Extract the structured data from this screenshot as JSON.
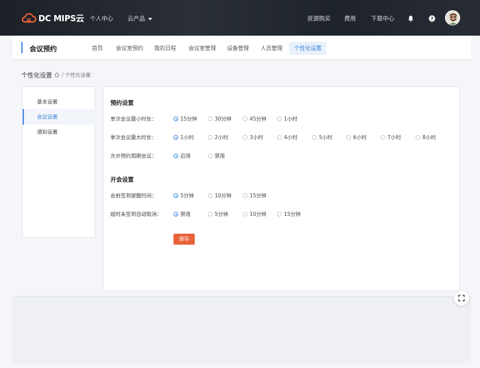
{
  "brand": {
    "logo_text": "DC MIPS云",
    "accent": "#e8623a",
    "primary": "#4a90e2"
  },
  "topnav": {
    "links": [
      "个人中心",
      "云产品"
    ],
    "right_links": [
      "资源购买",
      "费用",
      "下载中心"
    ],
    "icons": [
      "bell-icon",
      "help-icon"
    ]
  },
  "subheader": {
    "title": "会议预约",
    "tabs": [
      "首页",
      "会议室预约",
      "我的日程",
      "会议室管理",
      "设备管理",
      "人员管理",
      "个性化设置"
    ],
    "active_tab": "个性化设置"
  },
  "breadcrumb": {
    "page_title": "个性化设置",
    "path": "/ 个性化设置"
  },
  "sidemenu": {
    "items": [
      "基本设置",
      "会议设置",
      "通知设置"
    ],
    "active": "会议设置"
  },
  "booking": {
    "title": "预约设置",
    "min_duration": {
      "label": "单次会议最小时长：",
      "options": [
        "15分钟",
        "30分钟",
        "45分钟",
        "1小时"
      ],
      "selected": "15分钟"
    },
    "max_duration": {
      "label": "单次会议最大时长：",
      "options": [
        "1小时",
        "2小时",
        "3小时",
        "4小时",
        "5小时",
        "6小时",
        "7小时",
        "8小时"
      ],
      "selected": "1小时"
    },
    "recurring": {
      "label": "允许预约周期会议：",
      "options": [
        "启用",
        "禁用"
      ],
      "selected": "启用"
    }
  },
  "meeting": {
    "title": "开会设置",
    "reminder": {
      "label": "会前签到提醒时间：",
      "options": [
        "5分钟",
        "10分钟",
        "15分钟"
      ],
      "selected": "5分钟"
    },
    "auto_cancel": {
      "label": "超时未签到自动取消：",
      "options": [
        "禁用",
        "5分钟",
        "10分钟",
        "15分钟"
      ],
      "selected": "禁用"
    }
  },
  "actions": {
    "save_label": "保存"
  }
}
